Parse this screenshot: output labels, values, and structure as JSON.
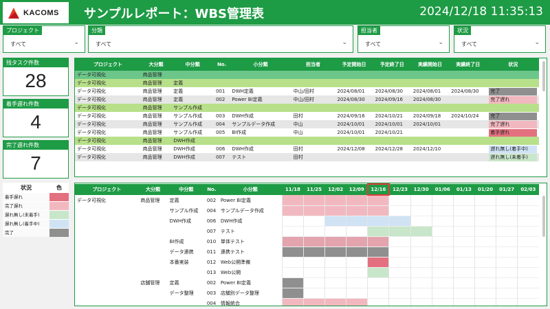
{
  "header": {
    "logo_text": "KACOMS",
    "title": "サンプルレポート：WBS管理表",
    "datetime": "2024/12/18 11:35:13"
  },
  "filters": [
    {
      "label": "プロジェクト",
      "value": "すべて"
    },
    {
      "label": "分類",
      "value": "すべて"
    },
    {
      "label": "担当者",
      "value": "すべて"
    },
    {
      "label": "状況",
      "value": "すべて"
    }
  ],
  "kpis": [
    {
      "label": "残タスク件数",
      "value": "28"
    },
    {
      "label": "着手遅れ件数",
      "value": "4"
    },
    {
      "label": "完了遅れ件数",
      "value": "7"
    }
  ],
  "legend": {
    "header_status": "状況",
    "header_color": "色",
    "items": [
      {
        "name": "着手遅れ",
        "color": "#e3707e"
      },
      {
        "name": "完了遅れ",
        "color": "#f2b8c0"
      },
      {
        "name": "遅れ無し(未着手)",
        "color": "#c8e6c9"
      },
      {
        "name": "遅れ無し(着手中)",
        "color": "#cfe3f5"
      },
      {
        "name": "完了",
        "color": "#8f8f8f"
      }
    ]
  },
  "task_table": {
    "columns": [
      "プロジェクト",
      "大分類",
      "中分類",
      "No.",
      "小分類",
      "担当者",
      "予定開始日",
      "予定終了日",
      "実績開始日",
      "実績終了日",
      "状況"
    ],
    "rows": [
      {
        "type": "grp dark",
        "cells": [
          "データ可視化",
          "商品管理",
          "",
          "",
          "",
          "",
          "",
          "",
          "",
          "",
          ""
        ]
      },
      {
        "type": "grp",
        "cells": [
          "データ可視化",
          "商品管理",
          "定義",
          "",
          "",
          "",
          "",
          "",
          "",
          "",
          ""
        ]
      },
      {
        "type": "row",
        "cells": [
          "データ可視化",
          "商品管理",
          "定義",
          "001",
          "DWH定義",
          "中山/田村",
          "2024/08/01",
          "2024/08/30",
          "2024/08/01",
          "2024/08/30",
          "完了"
        ],
        "status_color": "#8f8f8f"
      },
      {
        "type": "row alt",
        "cells": [
          "データ可視化",
          "商品管理",
          "定義",
          "002",
          "Power BI定義",
          "中山/田村",
          "2024/08/30",
          "2024/09/16",
          "2024/08/30",
          "",
          "完了遅れ"
        ],
        "status_color": "#f2b8c0"
      },
      {
        "type": "grp",
        "cells": [
          "データ可視化",
          "商品管理",
          "サンプル作成",
          "",
          "",
          "",
          "",
          "",
          "",
          "",
          ""
        ]
      },
      {
        "type": "row",
        "cells": [
          "データ可視化",
          "商品管理",
          "サンプル作成",
          "003",
          "DWH作成",
          "田村",
          "2024/09/16",
          "2024/10/21",
          "2024/09/18",
          "2024/10/24",
          "完了"
        ],
        "status_color": "#8f8f8f"
      },
      {
        "type": "row alt",
        "cells": [
          "データ可視化",
          "商品管理",
          "サンプル作成",
          "004",
          "サンプルデータ作成",
          "中山",
          "2024/10/01",
          "2024/10/01",
          "2024/10/01",
          "",
          "完了遅れ"
        ],
        "status_color": "#f2b8c0"
      },
      {
        "type": "row",
        "cells": [
          "データ可視化",
          "商品管理",
          "サンプル作成",
          "005",
          "BI作成",
          "中山",
          "2024/10/01",
          "2024/10/21",
          "",
          "",
          "着手遅れ"
        ],
        "status_color": "#e3707e"
      },
      {
        "type": "grp",
        "cells": [
          "データ可視化",
          "商品管理",
          "DWH作成",
          "",
          "",
          "",
          "",
          "",
          "",
          "",
          ""
        ]
      },
      {
        "type": "row",
        "cells": [
          "データ可視化",
          "商品管理",
          "DWH作成",
          "006",
          "DWH作成",
          "田村",
          "2024/12/08",
          "2024/12/28",
          "2024/12/10",
          "",
          "遅れ無し(着手中)"
        ],
        "status_color": "#cfe3f5"
      },
      {
        "type": "row alt",
        "cells": [
          "データ可視化",
          "商品管理",
          "DWH作成",
          "007",
          "テスト",
          "田村",
          "",
          "",
          "",
          "",
          "遅れ無し(未着手)"
        ],
        "status_color": "#c8e6c9"
      }
    ]
  },
  "gantt": {
    "columns": [
      "プロジェクト",
      "大分類",
      "中分類",
      "No.",
      "小分類"
    ],
    "weeks": [
      "11/18",
      "11/25",
      "12/02",
      "12/09",
      "12/16",
      "12/23",
      "12/30",
      "01/06",
      "01/13",
      "01/20",
      "01/27",
      "02/03"
    ],
    "current_week": "12/16",
    "rows": [
      {
        "cells": [
          "データ可視化",
          "商品管理",
          "定義",
          "002",
          "Power BI定義"
        ],
        "bar": [
          {
            "from": 0,
            "to": 5,
            "color": "#f2b8c0"
          }
        ]
      },
      {
        "cells": [
          "",
          "",
          "サンプル作成",
          "004",
          "サンプルデータ作成"
        ],
        "bar": [
          {
            "from": 0,
            "to": 5,
            "color": "#f2b8c0"
          }
        ]
      },
      {
        "cells": [
          "",
          "",
          "DWH作成",
          "006",
          "DWH作成"
        ],
        "bar": [
          {
            "from": 2,
            "to": 6,
            "color": "#cfe3f5"
          }
        ]
      },
      {
        "cells": [
          "",
          "",
          "",
          "007",
          "テスト"
        ],
        "bar": [
          {
            "from": 4,
            "to": 7,
            "color": "#c8e6c9"
          }
        ]
      },
      {
        "cells": [
          "",
          "",
          "BI作成",
          "010",
          "単体テスト"
        ],
        "bar": [
          {
            "from": 0,
            "to": 5,
            "color": "#e3a4ae"
          }
        ]
      },
      {
        "cells": [
          "",
          "",
          "データ連携",
          "011",
          "連携テスト"
        ],
        "bar": [
          {
            "from": 0,
            "to": 5,
            "color": "#8f8f8f"
          }
        ]
      },
      {
        "cells": [
          "",
          "",
          "本番実装",
          "012",
          "Web公開準備"
        ],
        "bar": [
          {
            "from": 4,
            "to": 5,
            "color": "#e3707e"
          }
        ]
      },
      {
        "cells": [
          "",
          "",
          "",
          "013",
          "Web公開"
        ],
        "bar": [
          {
            "from": 4,
            "to": 5,
            "color": "#c8e6c9"
          }
        ]
      },
      {
        "cells": [
          "",
          "店舗管理",
          "定義",
          "002",
          "Power BI定義"
        ],
        "bar": [
          {
            "from": 0,
            "to": 1,
            "color": "#8f8f8f"
          }
        ]
      },
      {
        "cells": [
          "",
          "",
          "データ整理",
          "003",
          "店舗別データ整理"
        ],
        "bar": [
          {
            "from": 0,
            "to": 1,
            "color": "#8f8f8f"
          }
        ]
      },
      {
        "cells": [
          "",
          "",
          "",
          "004",
          "情報統合"
        ],
        "bar": [
          {
            "from": 0,
            "to": 4,
            "color": "#f2b8c0"
          }
        ]
      }
    ]
  }
}
